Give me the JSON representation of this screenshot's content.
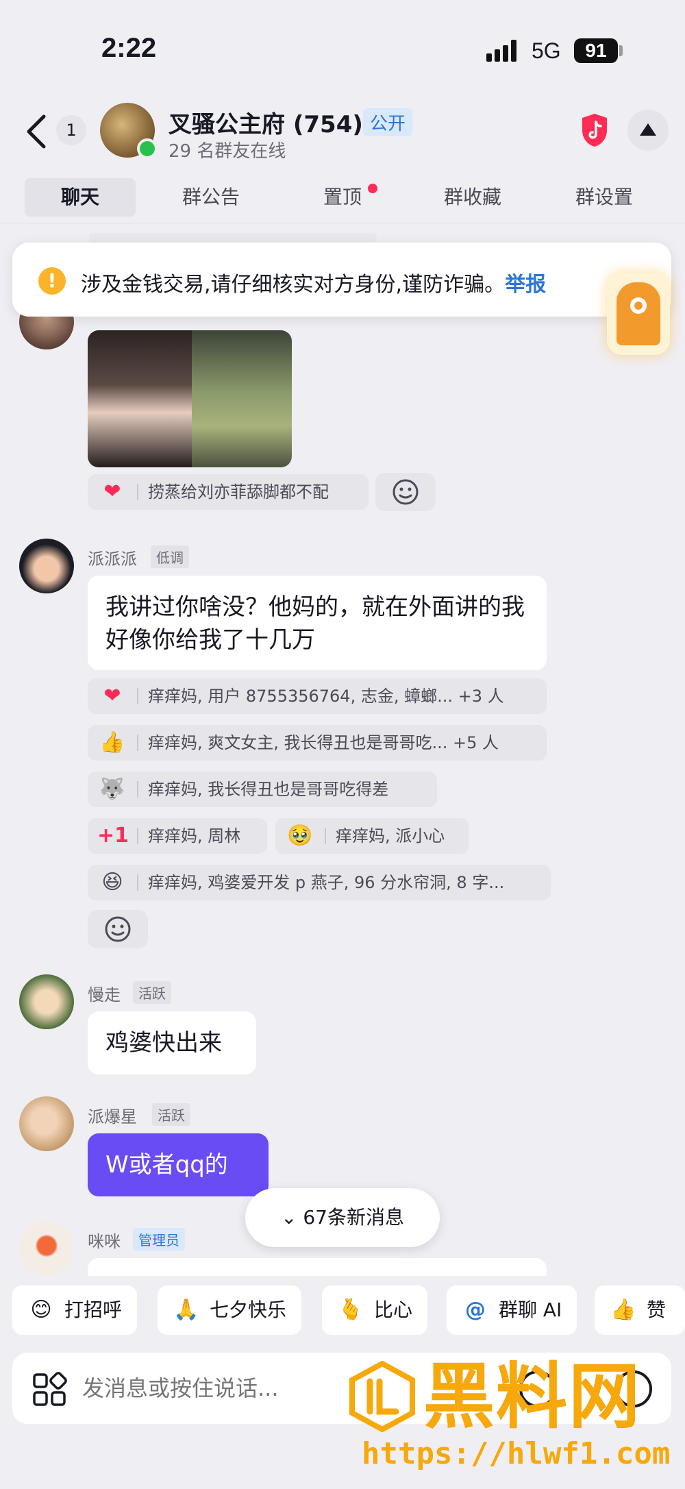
{
  "status_bar": {
    "time": "2:22",
    "network": "5G",
    "battery": "91"
  },
  "header": {
    "unread_count": "1",
    "group_name": "叉骚公主府 (754)",
    "public_tag": "公开",
    "online_text": "29 名群友在线"
  },
  "tabs": [
    {
      "label": "聊天",
      "active": true
    },
    {
      "label": "群公告",
      "active": false
    },
    {
      "label": "置顶",
      "active": false,
      "has_dot": true
    },
    {
      "label": "群收藏",
      "active": false
    },
    {
      "label": "群设置",
      "active": false
    }
  ],
  "warning": {
    "text": "涉及金钱交易,请仔细核实对方身份,谨防诈骗。",
    "report_label": "举报"
  },
  "messages": {
    "msg1": {
      "reaction": {
        "icon": "heart-icon",
        "text": "捞蒸给刘亦菲舔脚都不配"
      }
    },
    "msg2": {
      "sender": "派派派",
      "role": "低调",
      "text": "我讲过你啥没？他妈的，就在外面讲的我好像你给我了十几万",
      "reactions": [
        {
          "icon": "heart-icon",
          "text": "痒痒妈, 用户 8755356764, 志金, 蟑螂... +3 人"
        },
        {
          "icon": "thumbs-up-icon",
          "text": "痒痒妈, 爽文女主, 我长得丑也是哥哥吃... +5 人"
        },
        {
          "icon": "husky-icon",
          "text": "痒痒妈, 我长得丑也是哥哥吃得差"
        },
        {
          "icon": "plus-one-icon",
          "text": "痒痒妈, 周林"
        },
        {
          "icon": "teary-face-icon",
          "text": "痒痒妈, 派小心"
        },
        {
          "icon": "laughing-face-icon",
          "text": "痒痒妈, 鸡婆爱开发 p 燕子, 96 分水帘洞, 8 字..."
        }
      ]
    },
    "msg3": {
      "sender": "慢走",
      "role": "活跃",
      "text": "鸡婆快出来"
    },
    "msg4": {
      "sender": "派爆星",
      "role": "活跃",
      "text": "W或者qq的"
    },
    "msg5": {
      "sender": "咪咪",
      "role": "管理员"
    }
  },
  "new_messages_label": "67条新消息",
  "quick_actions": [
    {
      "icon": "wave-face-icon",
      "label": "打招呼"
    },
    {
      "icon": "hands-icon",
      "label": "七夕快乐"
    },
    {
      "icon": "heart-hand-icon",
      "label": "比心"
    },
    {
      "icon": "at-icon",
      "label": "群聊 AI"
    },
    {
      "icon": "thumbs-up-icon",
      "label": "赞"
    }
  ],
  "input": {
    "placeholder": "发消息或按住说话..."
  },
  "watermark": {
    "title": "黑料网",
    "url": "https://hlwf1.com"
  },
  "colors": {
    "accent": "#fe2c55",
    "purple_bubble": "#6a4cf4",
    "link_blue": "#2a76d8",
    "watermark": "#f7a80a"
  }
}
